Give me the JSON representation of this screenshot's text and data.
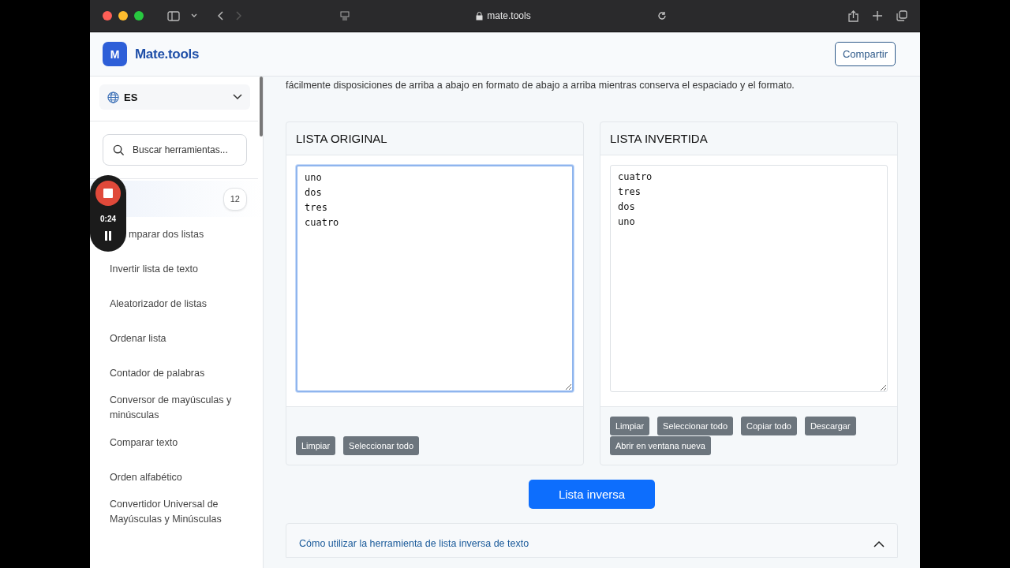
{
  "browser": {
    "url": "mate.tools"
  },
  "header": {
    "logo_letter": "M",
    "brand": "Mate.tools",
    "share_button": "Compartir"
  },
  "sidebar": {
    "language": "ES",
    "search": {
      "placeholder": "Buscar herramientas..."
    },
    "items": [
      {
        "badge": "12",
        "selected": true
      },
      {
        "label": "mparar dos listas",
        "selected": false
      },
      {
        "label": "Invertir lista de texto",
        "selected": false
      },
      {
        "label": "Aleatorizador de listas",
        "selected": false
      },
      {
        "label": "Ordenar lista",
        "selected": false
      },
      {
        "label": "Contador de palabras",
        "selected": false
      },
      {
        "label": "Conversor de mayúsculas y minúsculas",
        "selected": false
      },
      {
        "label": "Comparar texto",
        "selected": false
      },
      {
        "label": "Orden alfabético",
        "selected": false
      },
      {
        "label": "Convertidor Universal de Mayúsculas y Minúsculas",
        "selected": false
      }
    ]
  },
  "recorder": {
    "time": "0:24"
  },
  "intro": "fácilmente disposiciones de arriba a abajo en formato de abajo a arriba mientras conserva el espaciado y el formato.",
  "panels": [
    {
      "title": "LISTA ORIGINAL",
      "lines": [
        "uno",
        "dos",
        "tres",
        "cuatro"
      ],
      "focused": true,
      "buttons": [
        "Limpiar",
        "Seleccionar todo"
      ]
    },
    {
      "title": "LISTA INVERTIDA",
      "lines": [
        "cuatro",
        "tres",
        "dos",
        "uno"
      ],
      "focused": false,
      "buttons": [
        "Limpiar",
        "Seleccionar todo",
        "Copiar todo",
        "Descargar",
        "Abrir en ventana nueva"
      ]
    }
  ],
  "primary_button": "Lista inversa",
  "accordion": {
    "title": "Cómo utilizar la herramienta de lista inversa de texto",
    "expanded": true
  }
}
